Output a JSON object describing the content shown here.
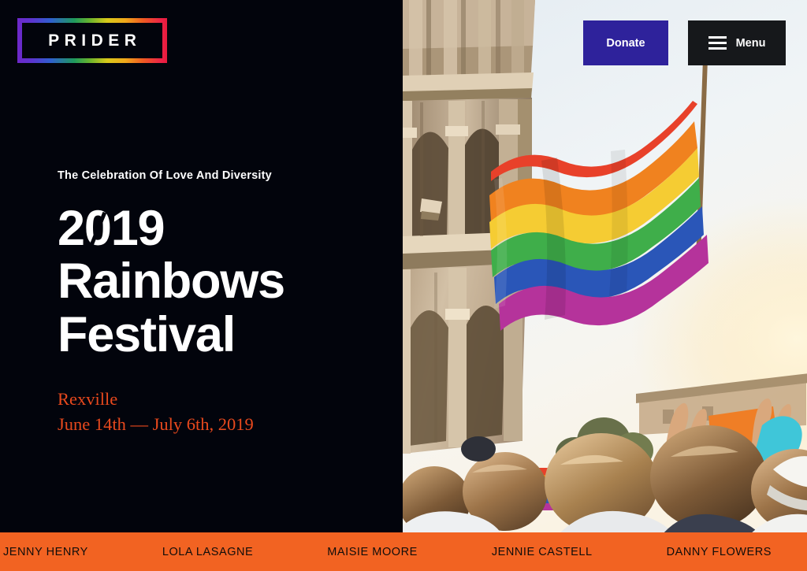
{
  "site": {
    "logo_text": "PRIDER",
    "logo_gradient": [
      "#6d28c9",
      "#2f5fd0",
      "#1f9a5d",
      "#d8c91a",
      "#f0a81a",
      "#e81b3c"
    ]
  },
  "header": {
    "donate_label": "Donate",
    "menu_label": "Menu",
    "donate_color": "#2e229b",
    "menu_color": "#16181b"
  },
  "hero": {
    "eyebrow": "The Celebration Of Love And Diversity",
    "headline_lines": [
      "2019",
      "Rainbows",
      "Festival"
    ],
    "headline_year_prefix": "2",
    "headline_year_zero": "0",
    "headline_year_suffix": "19",
    "location": "Rexville",
    "dates": "June 14th — July 6th, 2019",
    "accent_color": "#e8491d",
    "background_color": "#02040c"
  },
  "photo": {
    "alt": "Crowd at a pride parade waving a large rainbow flag in front of the Colosseum",
    "sky_color": "#eef3f6",
    "stone_color": "#c9b49c",
    "flag_stripes": [
      "#e8412a",
      "#f0821f",
      "#f5cc33",
      "#3fae4a",
      "#2a56b8",
      "#b5339b"
    ]
  },
  "ticker": {
    "background": "#f26322",
    "text_color": "#100d0b",
    "names": [
      "JENNY HENRY",
      "LOLA LASAGNE",
      "MAISIE MOORE",
      "JENNIE CASTELL",
      "DANNY FLOWERS",
      "JENNY HENRY"
    ]
  }
}
